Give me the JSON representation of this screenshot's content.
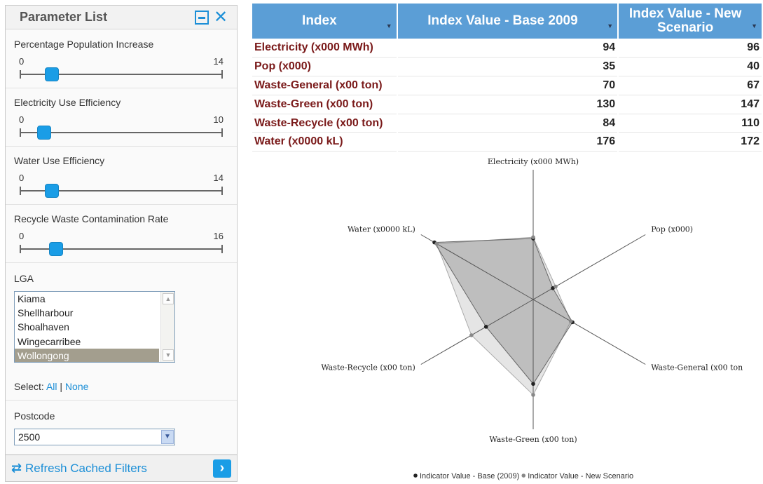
{
  "panel": {
    "title": "Parameter List",
    "sliders": [
      {
        "label": "Percentage Population Increase",
        "min": "0",
        "max": "14",
        "value_fraction": 0.16
      },
      {
        "label": "Electricity Use Efficiency",
        "min": "0",
        "max": "10",
        "value_fraction": 0.12
      },
      {
        "label": "Water Use Efficiency",
        "min": "0",
        "max": "14",
        "value_fraction": 0.16
      },
      {
        "label": "Recycle Waste Contamination Rate",
        "min": "0",
        "max": "16",
        "value_fraction": 0.18
      }
    ],
    "lga": {
      "label": "LGA",
      "items": [
        "Kiama",
        "Shellharbour",
        "Shoalhaven",
        "Wingecarribee",
        "Wollongong"
      ],
      "selected": "Wollongong"
    },
    "select": {
      "prefix": "Select:",
      "all": "All",
      "separator": "|",
      "none": "None"
    },
    "postcode": {
      "label": "Postcode",
      "value": "2500"
    },
    "refresh_label": "Refresh Cached Filters",
    "accent_color": "#1c8fd7"
  },
  "table": {
    "headers": [
      "Index",
      "Index Value - Base 2009",
      "Index Value - New Scenario"
    ],
    "rows": [
      [
        "Electricity (x000 MWh)",
        "94",
        "96"
      ],
      [
        "Pop (x000)",
        "35",
        "40"
      ],
      [
        "Waste-General (x00 ton)",
        "70",
        "67"
      ],
      [
        "Waste-Green (x00 ton)",
        "130",
        "147"
      ],
      [
        "Waste-Recycle (x00 ton)",
        "84",
        "110"
      ],
      [
        "Water (x0000 kL)",
        "176",
        "172"
      ]
    ],
    "header_color": "#5b9ed6",
    "index_text_color": "#7a1a1a"
  },
  "chart_data": {
    "type": "radar",
    "axes": [
      "Electricity (x000 MWh)",
      "Pop (x000)",
      "Waste-General (x00 ton",
      "Waste-Green (x00 ton)",
      "Waste-Recycle (x00 ton)",
      "Water (x0000 kL)"
    ],
    "series": [
      {
        "name": "Indicator Value - Base (2009)",
        "values": [
          94,
          35,
          70,
          130,
          84,
          176
        ],
        "color": "#222222"
      },
      {
        "name": "Indicator Value - New Scenario",
        "values": [
          96,
          40,
          67,
          147,
          110,
          172
        ],
        "color": "#888888"
      }
    ],
    "rmax": 200,
    "legend": "bottom"
  }
}
